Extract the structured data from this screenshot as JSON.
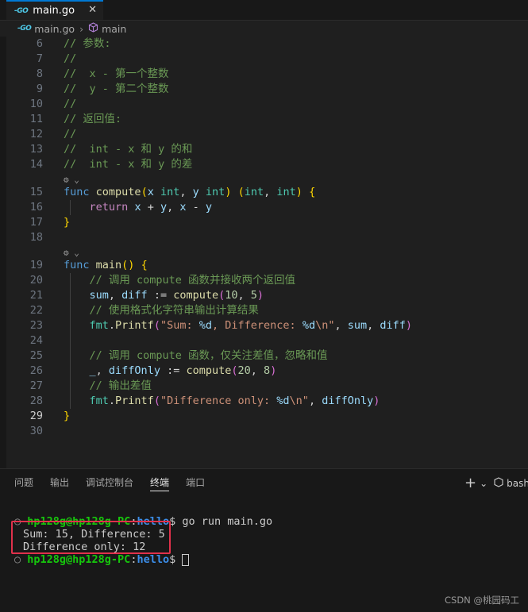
{
  "tab": {
    "icon": "go-icon",
    "label": "main.go",
    "close": "✕"
  },
  "breadcrumb": {
    "file": "main.go",
    "symbol": "main"
  },
  "editor": {
    "current_line": 29,
    "lines": [
      {
        "n": "6",
        "spans": [
          [
            "c-com",
            "// 参数:"
          ]
        ]
      },
      {
        "n": "7",
        "spans": [
          [
            "c-com",
            "//"
          ]
        ]
      },
      {
        "n": "8",
        "spans": [
          [
            "c-com",
            "//  x - 第一个整数"
          ]
        ]
      },
      {
        "n": "9",
        "spans": [
          [
            "c-com",
            "//  y - 第二个整数"
          ]
        ]
      },
      {
        "n": "10",
        "spans": [
          [
            "c-com",
            "//"
          ]
        ]
      },
      {
        "n": "11",
        "spans": [
          [
            "c-com",
            "// 返回值:"
          ]
        ]
      },
      {
        "n": "12",
        "spans": [
          [
            "c-com",
            "//"
          ]
        ]
      },
      {
        "n": "13",
        "spans": [
          [
            "c-com",
            "//  int - x 和 y 的和"
          ]
        ]
      },
      {
        "n": "14",
        "spans": [
          [
            "c-com",
            "//  int - x 和 y 的差"
          ]
        ]
      },
      {
        "n": "",
        "lens": "⚙ ⌄"
      },
      {
        "n": "15",
        "spans": [
          [
            "c-kw",
            "func"
          ],
          [
            "c-plain",
            " "
          ],
          [
            "c-fn",
            "compute"
          ],
          [
            "c-br",
            "("
          ],
          [
            "c-var",
            "x"
          ],
          [
            "c-plain",
            " "
          ],
          [
            "c-type",
            "int"
          ],
          [
            "c-plain",
            ", "
          ],
          [
            "c-var",
            "y"
          ],
          [
            "c-plain",
            " "
          ],
          [
            "c-type",
            "int"
          ],
          [
            "c-br",
            ")"
          ],
          [
            "c-plain",
            " "
          ],
          [
            "c-br",
            "("
          ],
          [
            "c-type",
            "int"
          ],
          [
            "c-plain",
            ", "
          ],
          [
            "c-type",
            "int"
          ],
          [
            "c-br",
            ")"
          ],
          [
            "c-plain",
            " "
          ],
          [
            "c-br",
            "{"
          ]
        ]
      },
      {
        "n": "16",
        "spans": [
          [
            "c-plain",
            "    "
          ],
          [
            "c-kw2",
            "return"
          ],
          [
            "c-plain",
            " "
          ],
          [
            "c-var",
            "x"
          ],
          [
            "c-plain",
            " + "
          ],
          [
            "c-var",
            "y"
          ],
          [
            "c-plain",
            ", "
          ],
          [
            "c-var",
            "x"
          ],
          [
            "c-plain",
            " - "
          ],
          [
            "c-var",
            "y"
          ]
        ]
      },
      {
        "n": "17",
        "spans": [
          [
            "c-br",
            "}"
          ]
        ]
      },
      {
        "n": "18",
        "spans": []
      },
      {
        "n": "",
        "lens": "⚙ ⌄"
      },
      {
        "n": "19",
        "spans": [
          [
            "c-kw",
            "func"
          ],
          [
            "c-plain",
            " "
          ],
          [
            "c-fn",
            "main"
          ],
          [
            "c-br",
            "()"
          ],
          [
            "c-plain",
            " "
          ],
          [
            "c-br",
            "{"
          ]
        ]
      },
      {
        "n": "20",
        "spans": [
          [
            "c-plain",
            "    "
          ],
          [
            "c-com",
            "// 调用 compute 函数并接收两个返回值"
          ]
        ]
      },
      {
        "n": "21",
        "spans": [
          [
            "c-plain",
            "    "
          ],
          [
            "c-var",
            "sum"
          ],
          [
            "c-plain",
            ", "
          ],
          [
            "c-var",
            "diff"
          ],
          [
            "c-plain",
            " := "
          ],
          [
            "c-fn",
            "compute"
          ],
          [
            "c-br2",
            "("
          ],
          [
            "c-num",
            "10"
          ],
          [
            "c-plain",
            ", "
          ],
          [
            "c-num",
            "5"
          ],
          [
            "c-br2",
            ")"
          ]
        ]
      },
      {
        "n": "22",
        "spans": [
          [
            "c-plain",
            "    "
          ],
          [
            "c-com",
            "// 使用格式化字符串输出计算结果"
          ]
        ]
      },
      {
        "n": "23",
        "spans": [
          [
            "c-plain",
            "    "
          ],
          [
            "c-type",
            "fmt"
          ],
          [
            "c-plain",
            "."
          ],
          [
            "c-fn",
            "Printf"
          ],
          [
            "c-br2",
            "("
          ],
          [
            "c-str",
            "\"Sum: "
          ],
          [
            "c-var",
            "%d"
          ],
          [
            "c-str",
            ", Difference: "
          ],
          [
            "c-var",
            "%d"
          ],
          [
            "c-str",
            "\\n\""
          ],
          [
            "c-plain",
            ", "
          ],
          [
            "c-var",
            "sum"
          ],
          [
            "c-plain",
            ", "
          ],
          [
            "c-var",
            "diff"
          ],
          [
            "c-br2",
            ")"
          ]
        ]
      },
      {
        "n": "24",
        "spans": []
      },
      {
        "n": "25",
        "spans": [
          [
            "c-plain",
            "    "
          ],
          [
            "c-com",
            "// 调用 compute 函数，仅关注差值，忽略和值"
          ]
        ]
      },
      {
        "n": "26",
        "spans": [
          [
            "c-plain",
            "    "
          ],
          [
            "c-var",
            "_"
          ],
          [
            "c-plain",
            ", "
          ],
          [
            "c-var",
            "diffOnly"
          ],
          [
            "c-plain",
            " := "
          ],
          [
            "c-fn",
            "compute"
          ],
          [
            "c-br2",
            "("
          ],
          [
            "c-num",
            "20"
          ],
          [
            "c-plain",
            ", "
          ],
          [
            "c-num",
            "8"
          ],
          [
            "c-br2",
            ")"
          ]
        ]
      },
      {
        "n": "27",
        "spans": [
          [
            "c-plain",
            "    "
          ],
          [
            "c-com",
            "// 输出差值"
          ]
        ]
      },
      {
        "n": "28",
        "spans": [
          [
            "c-plain",
            "    "
          ],
          [
            "c-type",
            "fmt"
          ],
          [
            "c-plain",
            "."
          ],
          [
            "c-fn",
            "Printf"
          ],
          [
            "c-br2",
            "("
          ],
          [
            "c-str",
            "\"Difference only: "
          ],
          [
            "c-var",
            "%d"
          ],
          [
            "c-str",
            "\\n\""
          ],
          [
            "c-plain",
            ", "
          ],
          [
            "c-var",
            "diffOnly"
          ],
          [
            "c-br2",
            ")"
          ]
        ]
      },
      {
        "n": "29",
        "spans": [
          [
            "c-br",
            "}"
          ]
        ]
      },
      {
        "n": "30",
        "spans": []
      }
    ]
  },
  "panel": {
    "tabs": [
      "问题",
      "输出",
      "调试控制台",
      "终端",
      "端口"
    ],
    "active_tab": "终端",
    "new_terminal": "+",
    "dropdown": "⌄",
    "shell": "bash"
  },
  "terminal": {
    "prompt_user": "hp128g@hp128g-PC",
    "prompt_sep": ":",
    "prompt_path": "hello",
    "prompt_end": "$",
    "command": " go run main.go",
    "output": [
      "Sum: 15, Difference: 5",
      "Difference only: 12"
    ]
  },
  "watermark": "CSDN @桃园码工"
}
